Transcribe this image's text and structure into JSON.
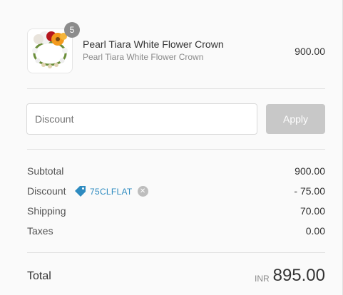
{
  "product": {
    "quantity": "5",
    "title": "Pearl Tiara White Flower Crown",
    "variant": "Pearl Tiara White Flower Crown",
    "price": "900.00"
  },
  "discount_form": {
    "placeholder": "Discount",
    "apply_label": "Apply"
  },
  "summary": {
    "subtotal_label": "Subtotal",
    "subtotal_value": "900.00",
    "discount_label": "Discount",
    "discount_code": "75CLFLAT",
    "discount_value": "- 75.00",
    "shipping_label": "Shipping",
    "shipping_value": "70.00",
    "taxes_label": "Taxes",
    "taxes_value": "0.00"
  },
  "total": {
    "label": "Total",
    "currency": "INR",
    "value": "895.00"
  },
  "colors": {
    "accent_link": "#2e8bc0",
    "apply_disabled": "#c8c8c8",
    "badge": "#8c8c8c"
  }
}
